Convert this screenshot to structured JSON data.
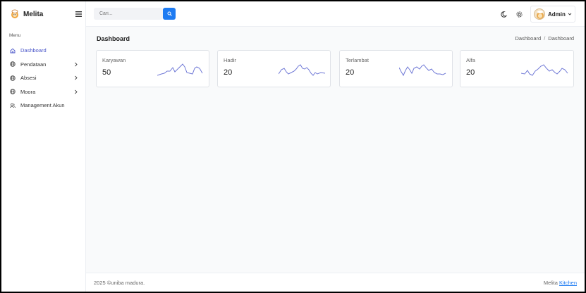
{
  "brand": {
    "name": "Melita",
    "logo_icon": "chef-logo-icon"
  },
  "sidebar": {
    "menu_title": "Menu",
    "items": [
      {
        "label": "Dashboard",
        "icon": "home-icon",
        "active": true,
        "has_children": false
      },
      {
        "label": "Pendataan",
        "icon": "globe-icon",
        "active": false,
        "has_children": true
      },
      {
        "label": "Absesi",
        "icon": "globe-icon",
        "active": false,
        "has_children": true
      },
      {
        "label": "Moora",
        "icon": "globe-icon",
        "active": false,
        "has_children": true
      },
      {
        "label": "Management Akun",
        "icon": "users-icon",
        "active": false,
        "has_children": false
      }
    ]
  },
  "header": {
    "search_placeholder": "Cari...",
    "user_name": "Admin"
  },
  "main": {
    "page_title": "Dashboard",
    "breadcrumb": [
      "Dashboard",
      "Dashboard"
    ],
    "cards": [
      {
        "label": "Karyawan",
        "value": "50"
      },
      {
        "label": "Hadir",
        "value": "20"
      },
      {
        "label": "Terlambat",
        "value": "20"
      },
      {
        "label": "Alfa",
        "value": "20"
      }
    ]
  },
  "footer": {
    "copyright": "2025 ©uniba madura.",
    "credit_text": "Melita",
    "credit_link": "Kitchen"
  },
  "colors": {
    "accent": "#4a56c9",
    "primary_button": "#1e7bf2",
    "sparkline": "#6f78d6"
  }
}
